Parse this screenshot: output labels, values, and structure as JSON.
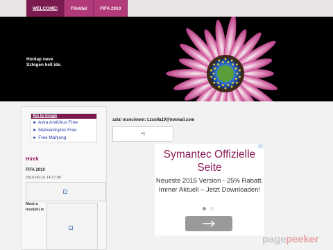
{
  "nav": {
    "items": [
      {
        "label": "WELCOME!",
        "active": true
      },
      {
        "label": "Főoldal",
        "active": false
      },
      {
        "label": "FIFA 2010",
        "active": false
      }
    ]
  },
  "header": {
    "site_name": "Honlap neve",
    "slogan": "Szlogen kell ide."
  },
  "sidebar": {
    "ads_heading": "Ads by Google",
    "ad_links": [
      "► Avira AntiVirus Free",
      "► Malwarebytes Free",
      "► Free Mahjong"
    ],
    "news_heading": "Hírek",
    "news_title": "FIFA 2010",
    "news_date": "2010-06-16 14:17:00",
    "now_label": "Most a lesz(ek) is"
  },
  "main": {
    "status_line": "szia! msncimem: t.zsolla10@hotmail.com",
    "reply_text": "=)"
  },
  "ad_widget": {
    "title": "Symantec Offizielle Seite",
    "body": "Neueste 2015 Version - 25% Rabatt. Immer Aktuell – Jetzt Downloaden!",
    "badge": "▷",
    "dot_active": "#9a9a9a",
    "dot_inactive": "#dddddd"
  },
  "watermark": {
    "part1": "page",
    "part2": "peeker"
  },
  "colors": {
    "nav_bg": "#b33a7a",
    "nav_active": "#7c1b50",
    "accent": "#9a1b5a",
    "ad_title": "#8a1a56"
  }
}
